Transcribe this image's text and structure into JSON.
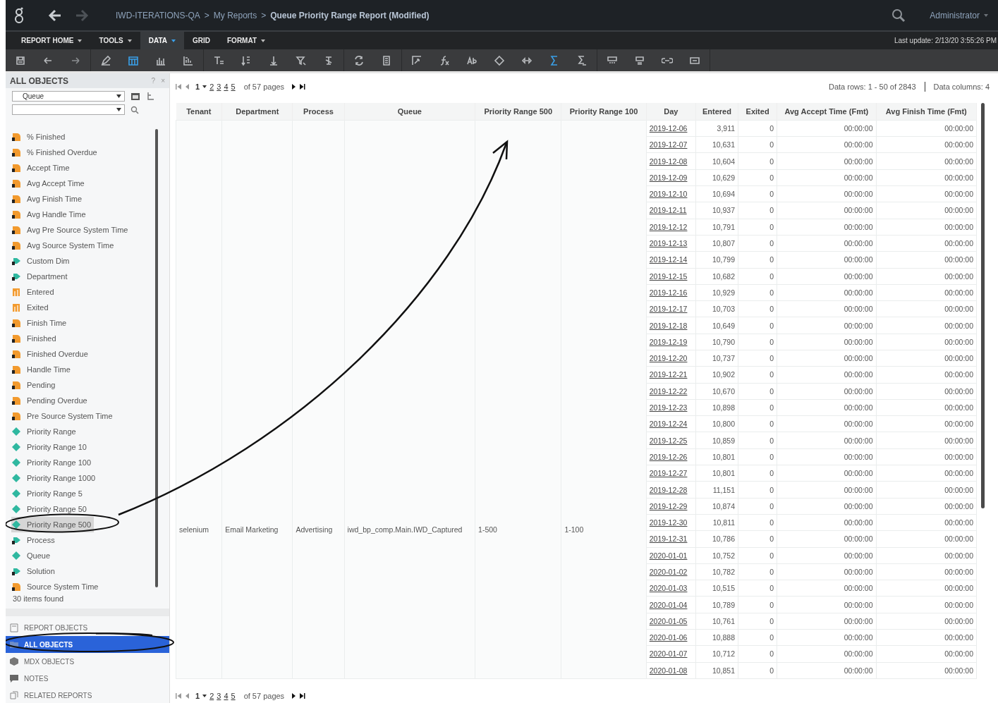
{
  "breadcrumb": {
    "separator": ">",
    "crumbs": [
      {
        "label": "IWD-ITERATIONS-QA",
        "current": false
      },
      {
        "label": "My Reports",
        "current": false
      },
      {
        "label": "Queue Priority Range Report (Modified)",
        "current": true
      }
    ]
  },
  "user": "Administrator",
  "menu": [
    {
      "label": "REPORT HOME",
      "selected": false,
      "has_menu": true
    },
    {
      "label": "TOOLS",
      "selected": false,
      "has_menu": true
    },
    {
      "label": "DATA",
      "selected": true,
      "has_menu": true
    },
    {
      "label": "GRID",
      "selected": false,
      "has_menu": false
    },
    {
      "label": "FORMAT",
      "selected": false,
      "has_menu": true
    }
  ],
  "last_update": "Last update: 2/13/20 3:55:26 PM",
  "panel": {
    "title": "ALL OBJECTS",
    "help": "?",
    "close": "×",
    "object_type": "Queue",
    "count": "30 items found",
    "items": [
      {
        "label": "% Finished",
        "kind": "metric",
        "selected": false
      },
      {
        "label": "% Finished Overdue",
        "kind": "metric",
        "selected": false
      },
      {
        "label": "Accept Time",
        "kind": "metric",
        "selected": false
      },
      {
        "label": "Avg Accept Time",
        "kind": "metric",
        "selected": false
      },
      {
        "label": "Avg Finish Time",
        "kind": "metric",
        "selected": false
      },
      {
        "label": "Avg Handle Time",
        "kind": "metric",
        "selected": false
      },
      {
        "label": "Avg Pre Source System Time",
        "kind": "metric",
        "selected": false
      },
      {
        "label": "Avg Source System Time",
        "kind": "metric",
        "selected": false
      },
      {
        "label": "Custom Dim",
        "kind": "hierarchy",
        "selected": false
      },
      {
        "label": "Department",
        "kind": "hierarchy",
        "selected": false
      },
      {
        "label": "Entered",
        "kind": "fact",
        "selected": false
      },
      {
        "label": "Exited",
        "kind": "fact",
        "selected": false
      },
      {
        "label": "Finish Time",
        "kind": "metric",
        "selected": false
      },
      {
        "label": "Finished",
        "kind": "metric",
        "selected": false
      },
      {
        "label": "Finished Overdue",
        "kind": "metric",
        "selected": false
      },
      {
        "label": "Handle Time",
        "kind": "metric",
        "selected": false
      },
      {
        "label": "Pending",
        "kind": "metric",
        "selected": false
      },
      {
        "label": "Pending Overdue",
        "kind": "metric",
        "selected": false
      },
      {
        "label": "Pre Source System Time",
        "kind": "metric",
        "selected": false
      },
      {
        "label": "Priority Range",
        "kind": "attribute",
        "selected": false
      },
      {
        "label": "Priority Range 10",
        "kind": "attribute",
        "selected": false
      },
      {
        "label": "Priority Range 100",
        "kind": "attribute",
        "selected": false
      },
      {
        "label": "Priority Range 1000",
        "kind": "attribute",
        "selected": false
      },
      {
        "label": "Priority Range 5",
        "kind": "attribute",
        "selected": false
      },
      {
        "label": "Priority Range 50",
        "kind": "attribute",
        "selected": false
      },
      {
        "label": "Priority Range 500",
        "kind": "attribute",
        "selected": true
      },
      {
        "label": "Process",
        "kind": "hierarchy",
        "selected": false
      },
      {
        "label": "Queue",
        "kind": "attribute",
        "selected": false
      },
      {
        "label": "Solution",
        "kind": "hierarchy",
        "selected": false
      },
      {
        "label": "Source System Time",
        "kind": "metric",
        "selected": false
      }
    ],
    "sections": [
      {
        "label": "REPORT OBJECTS",
        "kind": "report",
        "selected": false
      },
      {
        "label": "ALL OBJECTS",
        "kind": "all",
        "selected": true
      },
      {
        "label": "MDX OBJECTS",
        "kind": "mdx",
        "selected": false
      },
      {
        "label": "NOTES",
        "kind": "notes",
        "selected": false
      },
      {
        "label": "RELATED REPORTS",
        "kind": "related",
        "selected": false
      }
    ]
  },
  "pager_top": {
    "current": "1",
    "pages": [
      "2",
      "3",
      "4",
      "5"
    ],
    "total": "of 57 pages"
  },
  "data_rows": "Data rows: 1 - 50 of 2843",
  "data_columns": "Data columns: 4",
  "table": {
    "columns": [
      "Tenant",
      "Department",
      "Process",
      "Queue",
      "Priority Range 500",
      "Priority Range 100",
      "Day",
      "Entered",
      "Exited",
      "Avg Accept Time (Fmt)",
      "Avg Finish Time (Fmt)"
    ],
    "merged": [
      "selenium",
      "Email Marketing",
      "Advertising",
      "iwd_bp_comp.Main.IWD_Captured",
      "1-500",
      "1-100"
    ],
    "rows": [
      [
        "2019-12-06",
        "3,911",
        "0",
        "00:00:00",
        "00:00:00"
      ],
      [
        "2019-12-07",
        "10,631",
        "0",
        "00:00:00",
        "00:00:00"
      ],
      [
        "2019-12-08",
        "10,604",
        "0",
        "00:00:00",
        "00:00:00"
      ],
      [
        "2019-12-09",
        "10,629",
        "0",
        "00:00:00",
        "00:00:00"
      ],
      [
        "2019-12-10",
        "10,694",
        "0",
        "00:00:00",
        "00:00:00"
      ],
      [
        "2019-12-11",
        "10,937",
        "0",
        "00:00:00",
        "00:00:00"
      ],
      [
        "2019-12-12",
        "10,791",
        "0",
        "00:00:00",
        "00:00:00"
      ],
      [
        "2019-12-13",
        "10,807",
        "0",
        "00:00:00",
        "00:00:00"
      ],
      [
        "2019-12-14",
        "10,799",
        "0",
        "00:00:00",
        "00:00:00"
      ],
      [
        "2019-12-15",
        "10,682",
        "0",
        "00:00:00",
        "00:00:00"
      ],
      [
        "2019-12-16",
        "10,929",
        "0",
        "00:00:00",
        "00:00:00"
      ],
      [
        "2019-12-17",
        "10,703",
        "0",
        "00:00:00",
        "00:00:00"
      ],
      [
        "2019-12-18",
        "10,649",
        "0",
        "00:00:00",
        "00:00:00"
      ],
      [
        "2019-12-19",
        "10,790",
        "0",
        "00:00:00",
        "00:00:00"
      ],
      [
        "2019-12-20",
        "10,737",
        "0",
        "00:00:00",
        "00:00:00"
      ],
      [
        "2019-12-21",
        "10,902",
        "0",
        "00:00:00",
        "00:00:00"
      ],
      [
        "2019-12-22",
        "10,670",
        "0",
        "00:00:00",
        "00:00:00"
      ],
      [
        "2019-12-23",
        "10,898",
        "0",
        "00:00:00",
        "00:00:00"
      ],
      [
        "2019-12-24",
        "10,800",
        "0",
        "00:00:00",
        "00:00:00"
      ],
      [
        "2019-12-25",
        "10,859",
        "0",
        "00:00:00",
        "00:00:00"
      ],
      [
        "2019-12-26",
        "10,801",
        "0",
        "00:00:00",
        "00:00:00"
      ],
      [
        "2019-12-27",
        "10,801",
        "0",
        "00:00:00",
        "00:00:00"
      ],
      [
        "2019-12-28",
        "11,151",
        "0",
        "00:00:00",
        "00:00:00"
      ],
      [
        "2019-12-29",
        "10,874",
        "0",
        "00:00:00",
        "00:00:00"
      ],
      [
        "2019-12-30",
        "10,811",
        "0",
        "00:00:00",
        "00:00:00"
      ],
      [
        "2019-12-31",
        "10,786",
        "0",
        "00:00:00",
        "00:00:00"
      ],
      [
        "2020-01-01",
        "10,752",
        "0",
        "00:00:00",
        "00:00:00"
      ],
      [
        "2020-01-02",
        "10,782",
        "0",
        "00:00:00",
        "00:00:00"
      ],
      [
        "2020-01-03",
        "10,515",
        "0",
        "00:00:00",
        "00:00:00"
      ],
      [
        "2020-01-04",
        "10,789",
        "0",
        "00:00:00",
        "00:00:00"
      ],
      [
        "2020-01-05",
        "10,761",
        "0",
        "00:00:00",
        "00:00:00"
      ],
      [
        "2020-01-06",
        "10,888",
        "0",
        "00:00:00",
        "00:00:00"
      ],
      [
        "2020-01-07",
        "10,712",
        "0",
        "00:00:00",
        "00:00:00"
      ],
      [
        "2020-01-08",
        "10,851",
        "0",
        "00:00:00",
        "00:00:00"
      ]
    ]
  },
  "pager_bottom": {
    "current": "1",
    "pages": [
      "2",
      "3",
      "4",
      "5"
    ],
    "total": "of 57 pages"
  }
}
